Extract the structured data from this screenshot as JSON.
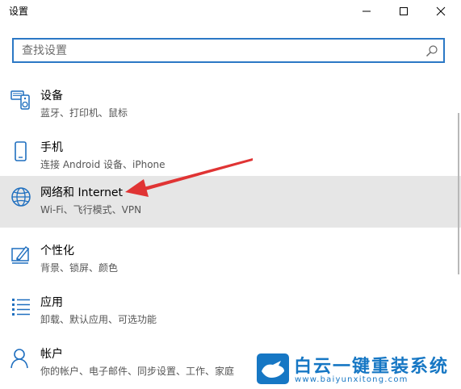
{
  "window": {
    "title": "设置"
  },
  "search": {
    "placeholder": "查找设置"
  },
  "items": [
    {
      "title": "设备",
      "desc": "蓝牙、打印机、鼠标",
      "icon": "devices-icon"
    },
    {
      "title": "手机",
      "desc": "连接 Android 设备、iPhone",
      "icon": "phone-icon"
    },
    {
      "title": "网络和 Internet",
      "desc": "Wi-Fi、飞行模式、VPN",
      "icon": "globe-icon",
      "selected": true
    },
    {
      "title": "个性化",
      "desc": "背景、锁屏、颜色",
      "icon": "personalization-icon"
    },
    {
      "title": "应用",
      "desc": "卸载、默认应用、可选功能",
      "icon": "apps-icon"
    },
    {
      "title": "帐户",
      "desc": "你的帐户、电子邮件、同步设置、工作、家庭",
      "icon": "account-icon"
    }
  ],
  "colors": {
    "accent": "#2b78c5",
    "selected_bg": "#e6e6e6",
    "arrow": "#e03434",
    "watermark": "#1677c4"
  },
  "watermark": {
    "title": "白云一键重装系统",
    "url": "www.baiyunxitong.com"
  }
}
